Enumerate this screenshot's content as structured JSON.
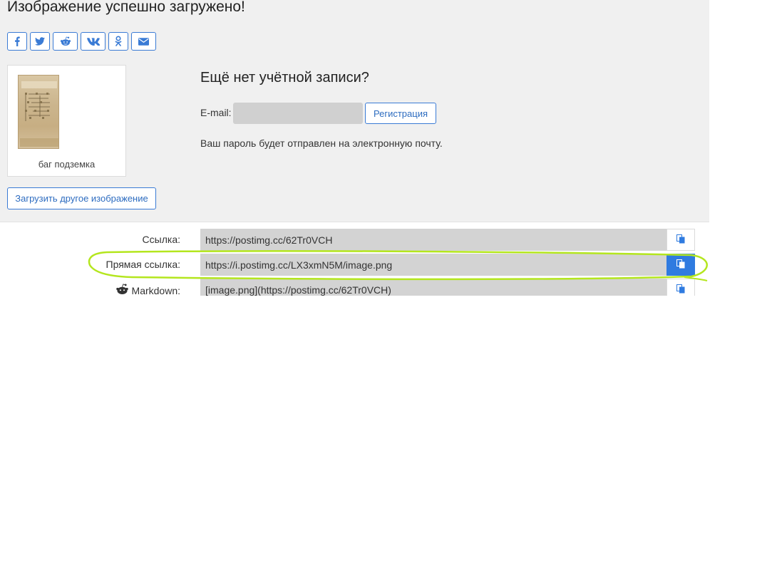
{
  "header": {
    "title": "Изображение успешно загружено!"
  },
  "share": {
    "buttons": [
      {
        "name": "facebook-icon"
      },
      {
        "name": "twitter-icon"
      },
      {
        "name": "reddit-icon"
      },
      {
        "name": "vk-icon"
      },
      {
        "name": "odnoklassniki-icon"
      },
      {
        "name": "email-icon"
      }
    ]
  },
  "thumbnail": {
    "caption": "баг подземка"
  },
  "upload_another_label": "Загрузить другое изображение",
  "account": {
    "heading": "Ещё нет учётной записи?",
    "email_label": "E-mail:",
    "email_value": "",
    "register_label": "Регистрация",
    "note": "Ваш пароль будет отправлен на электронную почту."
  },
  "links": [
    {
      "label": "Ссылка:",
      "value": "https://postimg.cc/62Tr0VCH",
      "copy_active": false
    },
    {
      "label": "Прямая ссылка:",
      "value": "https://i.postimg.cc/LX3xmN5M/image.png",
      "copy_active": true
    },
    {
      "label": "Markdown:",
      "value": "[image.png](https://postimg.cc/62Tr0VCH)",
      "copy_active": false,
      "icon": "reddit-icon"
    }
  ],
  "colors": {
    "accent": "#2f7be0",
    "panel_bg": "#f0f0f0",
    "field_bg": "#d3d3d3",
    "highlight": "#b4e61e"
  }
}
